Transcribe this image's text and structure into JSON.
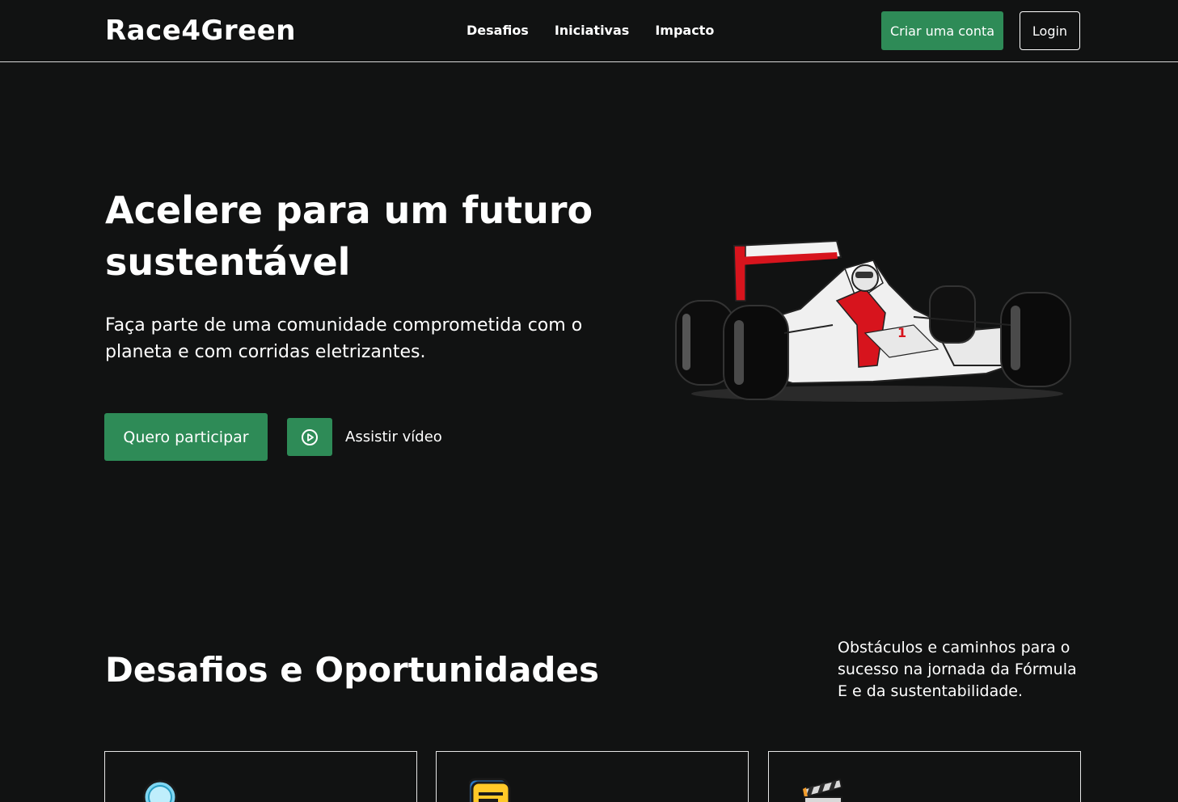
{
  "header": {
    "logo": "Race4Green",
    "nav": [
      {
        "label": "Desafios"
      },
      {
        "label": "Iniciativas"
      },
      {
        "label": "Impacto"
      }
    ],
    "create_account": "Criar uma conta",
    "login": "Login"
  },
  "hero": {
    "title": "Acelere para um futuro sustentável",
    "subtitle": "Faça parte de uma comunidade comprometida com o planeta e com corridas eletrizantes.",
    "cta_join": "Quero participar",
    "cta_video": "Assistir vídeo",
    "illustration": "formula-race-car"
  },
  "challenges": {
    "title": "Desafios e Oportunidades",
    "description": "Obstáculos e caminhos para o sucesso na jornada da Fórmula E e da sustentabilidade.",
    "cards": [
      {
        "icon": "magnifier-icon"
      },
      {
        "icon": "chat-bubble-icon"
      },
      {
        "icon": "clapperboard-icon"
      }
    ]
  },
  "colors": {
    "background": "#111212",
    "accent": "#2e8b57",
    "text": "#ffffff",
    "car_red": "#d7141d"
  }
}
